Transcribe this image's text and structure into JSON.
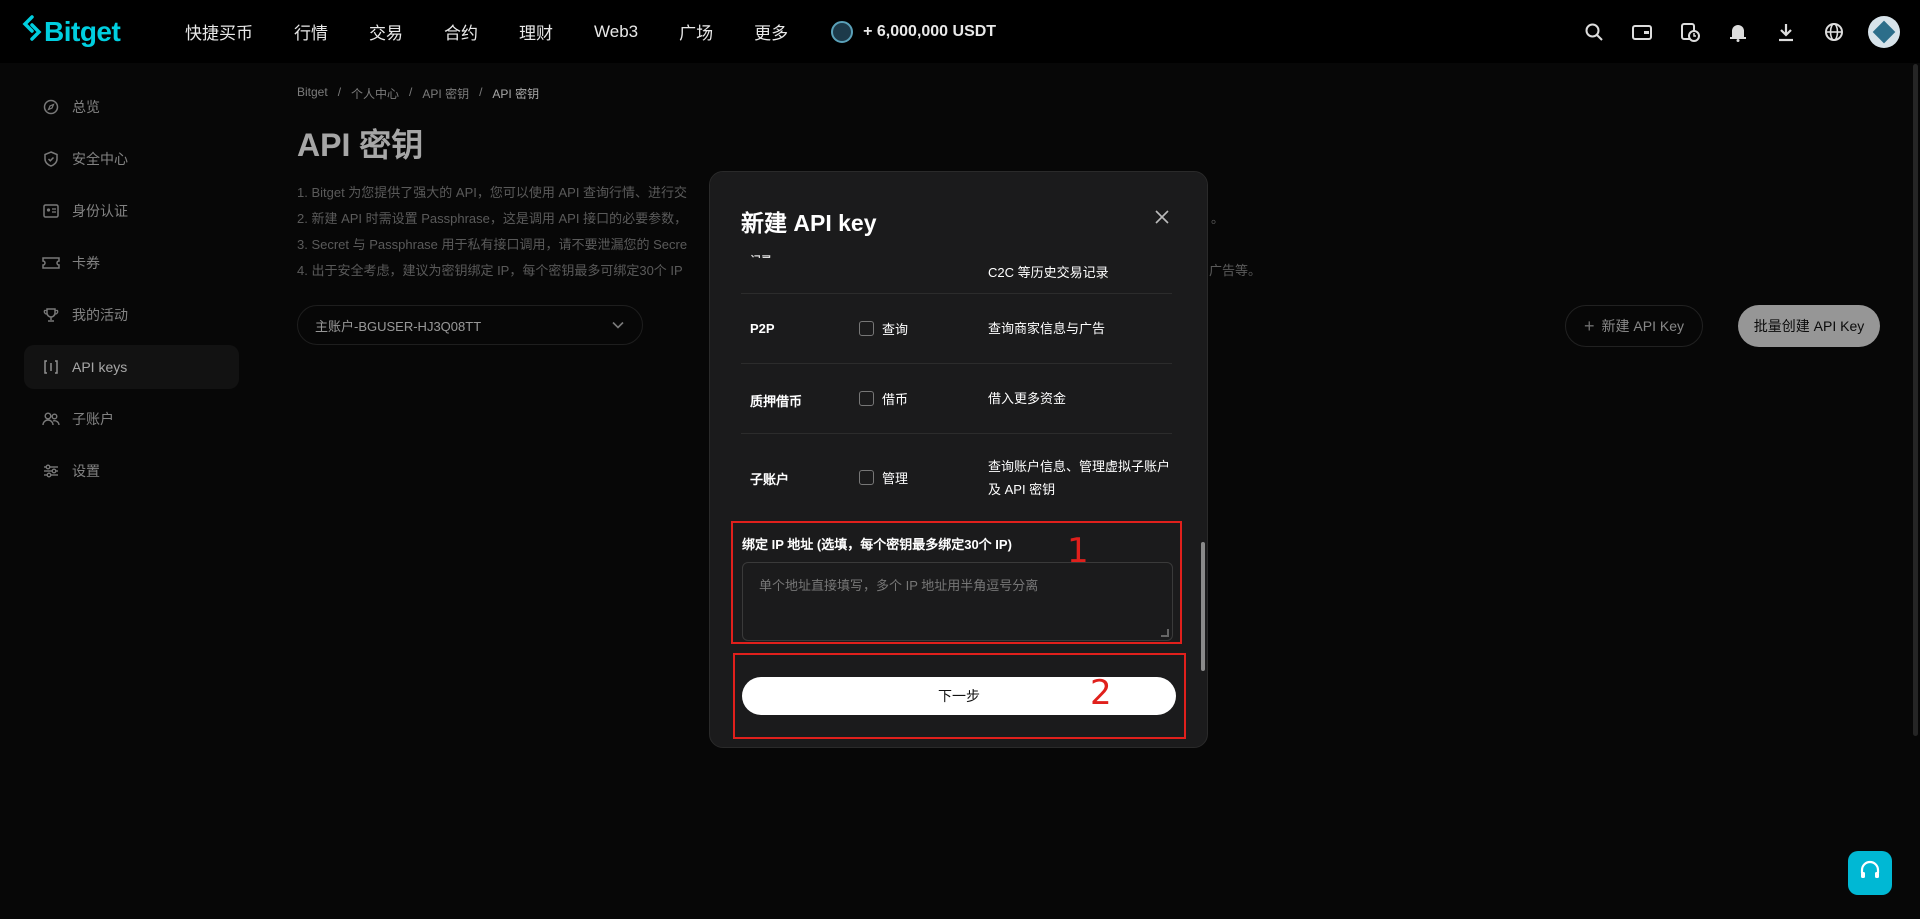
{
  "brand": {
    "name": "Bitget"
  },
  "nav": {
    "items": [
      "快捷买币",
      "行情",
      "交易",
      "合约",
      "理财",
      "Web3",
      "广场",
      "更多"
    ],
    "promo": "+ 6,000,000 USDT"
  },
  "top_icons": [
    "search-icon",
    "wallet-icon",
    "history-icon",
    "bell-icon",
    "download-icon",
    "globe-icon",
    "avatar"
  ],
  "sidebar": {
    "items": [
      {
        "label": "总览",
        "icon": "compass-icon"
      },
      {
        "label": "安全中心",
        "icon": "shield-icon"
      },
      {
        "label": "身份认证",
        "icon": "id-card-icon"
      },
      {
        "label": "卡券",
        "icon": "ticket-icon"
      },
      {
        "label": "我的活动",
        "icon": "trophy-icon"
      },
      {
        "label": "API keys",
        "icon": "api-icon"
      },
      {
        "label": "子账户",
        "icon": "users-icon"
      },
      {
        "label": "设置",
        "icon": "sliders-icon"
      }
    ],
    "active": "API keys"
  },
  "breadcrumb": {
    "items": [
      "Bitget",
      "个人中心",
      "API 密钥",
      "API 密钥"
    ],
    "separator": "/"
  },
  "page": {
    "title": "API 密钥",
    "notes": [
      "1. Bitget 为您提供了强大的 API，您可以使用 API 查询行情、进行交",
      "2. 新建 API 时需设置 Passphrase，这是调用 API 接口的必要参数，",
      "3. Secret 与 Passphrase 用于私有接口调用，请不要泄漏您的 Secre",
      "4. 出于安全考虑，建议为密钥绑定 IP，每个密钥最多可绑定30个 IP"
    ],
    "notes_tail": [
      "。",
      "广告等。"
    ],
    "account_select": "主账户-BGUSER-HJ3Q08TT",
    "new_key_button": "新建 API Key",
    "batch_button": "批量创建 API Key"
  },
  "modal": {
    "title": "新建 API key",
    "cut_row_desc": "C2C 等历史交易记录",
    "rows": [
      {
        "name": "P2P",
        "check": "查询",
        "desc": "查询商家信息与广告"
      },
      {
        "name": "质押借币",
        "check": "借币",
        "desc": "借入更多资金"
      },
      {
        "name": "子账户",
        "check": "管理",
        "desc": "查询账户信息、管理虚拟子账户及 API 密钥"
      }
    ],
    "ip_label": "绑定 IP 地址 (选填，每个密钥最多绑定30个 IP)",
    "ip_placeholder": "单个地址直接填写，多个 IP 地址用半角逗号分离",
    "next_button": "下一步"
  },
  "annotations": {
    "one": "1",
    "two": "2",
    "color": "#e0201c"
  },
  "colors": {
    "brand": "#00cfe0",
    "support": "#00b8d4"
  }
}
